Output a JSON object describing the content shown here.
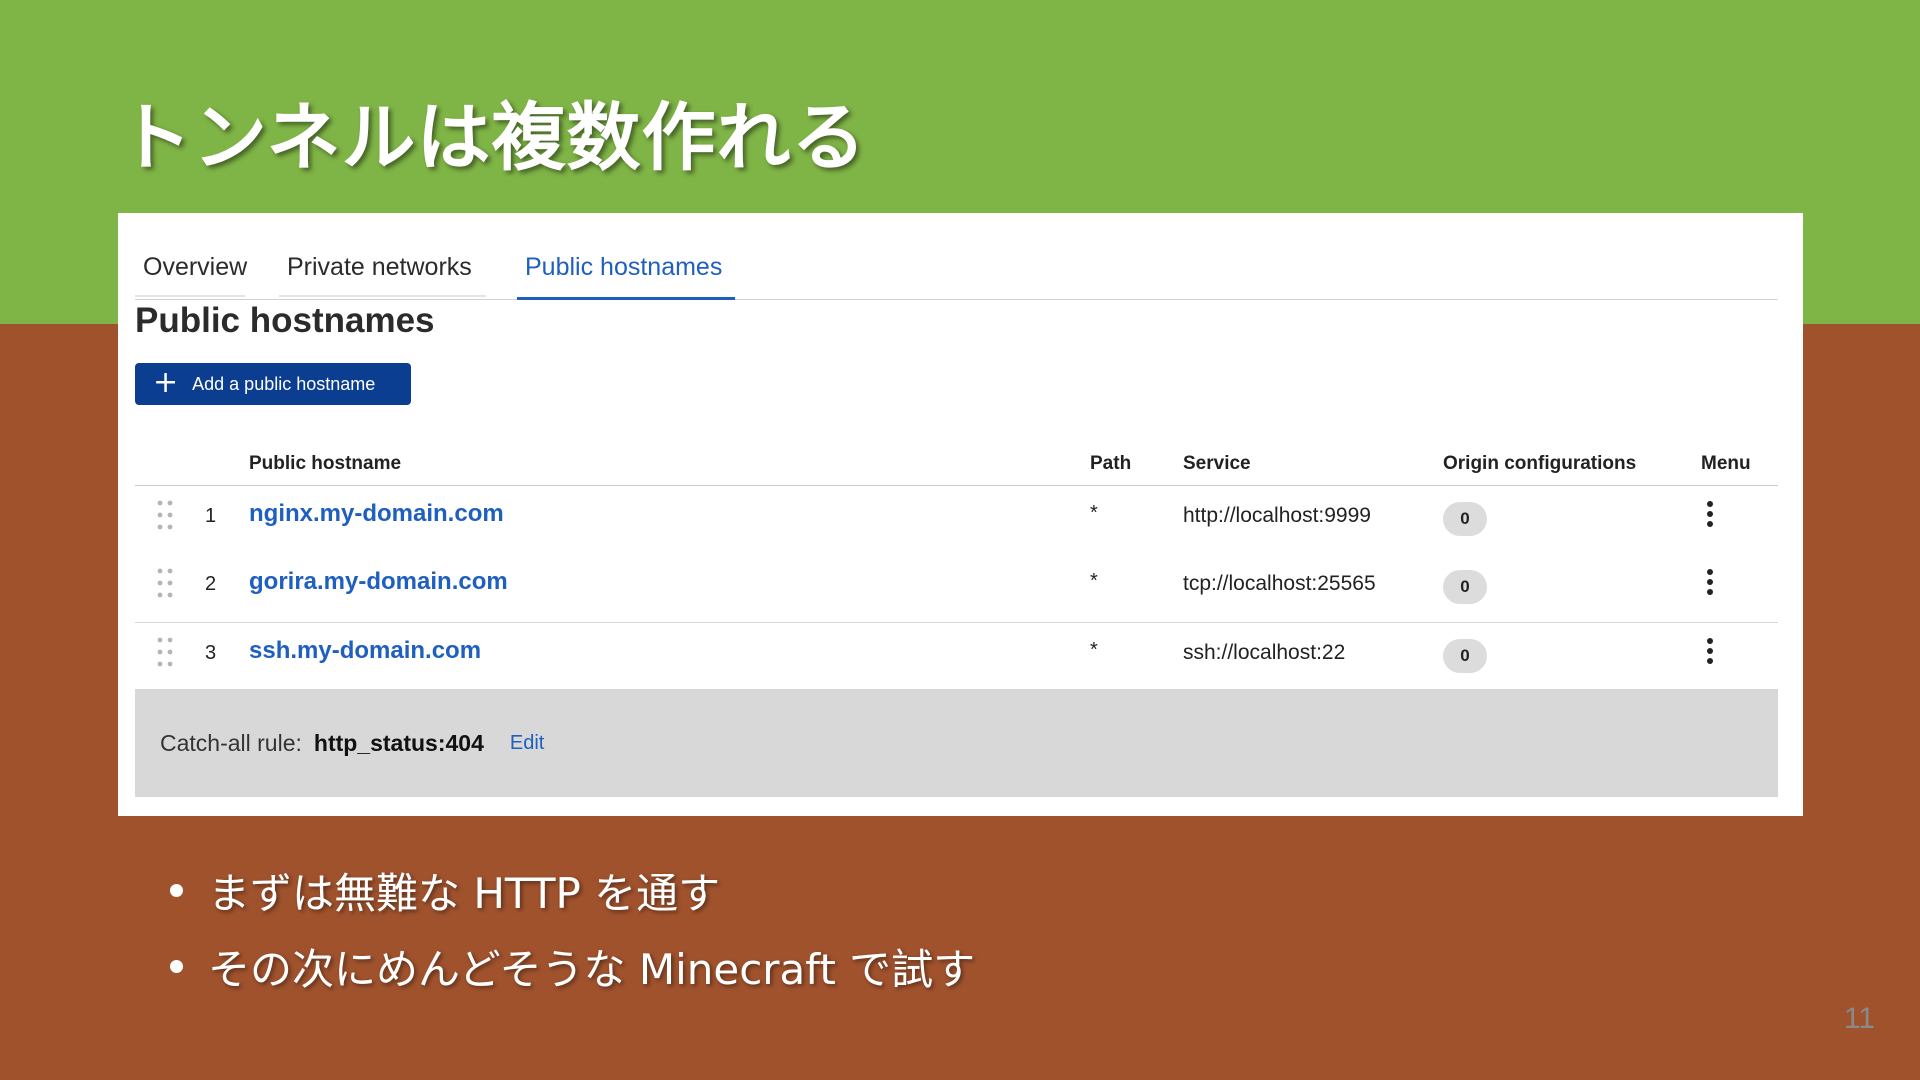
{
  "slide": {
    "title": "トンネルは複数作れる",
    "page_number": "11",
    "bullets": [
      "まずは無難な HTTP を通す",
      "その次にめんどそうな Minecraft で試す"
    ],
    "colors": {
      "top_background": "#7fb446",
      "bottom_background": "#a0522d"
    }
  },
  "tabs": [
    {
      "label": "Overview",
      "active": false
    },
    {
      "label": "Private networks",
      "active": false
    },
    {
      "label": "Public hostnames",
      "active": true
    }
  ],
  "section": {
    "title": "Public hostnames",
    "add_button_label": "Add a public hostname"
  },
  "table": {
    "headers": {
      "hostname": "Public hostname",
      "path": "Path",
      "service": "Service",
      "origin": "Origin configurations",
      "menu": "Menu"
    },
    "rows": [
      {
        "index": "1",
        "hostname": "nginx.my-domain.com",
        "path": "*",
        "service": "http://localhost:9999",
        "origin_count": "0"
      },
      {
        "index": "2",
        "hostname": "gorira.my-domain.com",
        "path": "*",
        "service": "tcp://localhost:25565",
        "origin_count": "0"
      },
      {
        "index": "3",
        "hostname": "ssh.my-domain.com",
        "path": "*",
        "service": "ssh://localhost:22",
        "origin_count": "0"
      }
    ]
  },
  "catch_all": {
    "label": "Catch-all rule:",
    "value": "http_status:404",
    "edit_label": "Edit"
  },
  "icons": {
    "add": "plus-icon",
    "drag": "drag-handle-icon",
    "menu": "kebab-menu-icon"
  },
  "accent_color": "#1f5fbf",
  "button_color": "#0b3d91"
}
